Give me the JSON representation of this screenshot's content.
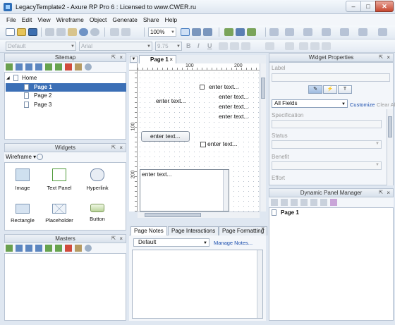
{
  "window": {
    "title": "LegacyTemplate2 - Axure RP Pro 6 : Licensed to www.CWER.ru",
    "min": "–",
    "max": "□",
    "close": "✕"
  },
  "menu": [
    "File",
    "Edit",
    "View",
    "Wireframe",
    "Object",
    "Generate",
    "Share",
    "Help"
  ],
  "toolbar": {
    "zoom": "100%",
    "font_style": "Default",
    "font_family": "Arial",
    "font_size": "9.75",
    "bold": "B",
    "italic": "I",
    "underline": "U"
  },
  "sitemap": {
    "title": "Sitemap",
    "root": "Home",
    "pages": [
      "Page 1",
      "Page 2",
      "Page 3"
    ],
    "selected_index": 0
  },
  "widgets": {
    "title": "Widgets",
    "library": "Wireframe",
    "items": [
      "Image",
      "Text Panel",
      "Hyperlink",
      "Rectangle",
      "Placeholder",
      "Button"
    ]
  },
  "masters": {
    "title": "Masters"
  },
  "canvas": {
    "tab": "Page 1",
    "close": "×",
    "ruler_top": [
      "100",
      "200"
    ],
    "ruler_left": [
      "100",
      "200"
    ],
    "labels": [
      "enter text...",
      "enter text...",
      "enter text...",
      "enter text...",
      "enter text...",
      "enter text..."
    ],
    "button_label": "enter text...",
    "checkbox_label": "enter text...",
    "textarea_value": "enter text..."
  },
  "page_notes": {
    "tabs": [
      "Page Notes",
      "Page Interactions",
      "Page Formatting"
    ],
    "active_tab": 0,
    "select_value": "Default",
    "manage_link": "Manage Notes..."
  },
  "widget_properties": {
    "title": "Widget Properties",
    "label_field": "Label",
    "filter_value": "All Fields",
    "customize_link": "Customize",
    "clear_all": "Clear All",
    "fields": [
      "Specification",
      "Status",
      "Benefit",
      "Effort"
    ]
  },
  "dynamic_panel_manager": {
    "title": "Dynamic Panel Manager",
    "items": [
      "Page 1"
    ]
  },
  "colors": {
    "selection": "#3b6fb6",
    "link": "#1c4fae",
    "panel_bg": "#dfe7f1"
  }
}
